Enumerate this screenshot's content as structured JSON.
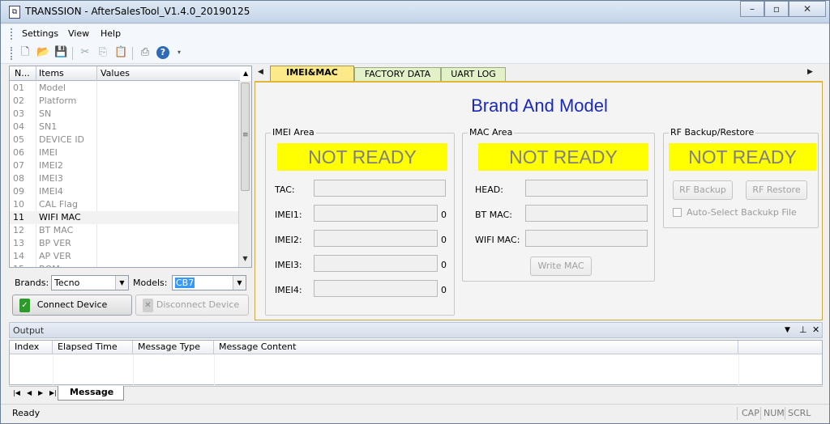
{
  "window": {
    "title": "TRANSSION - AfterSalesTool_V1.4.0_20190125"
  },
  "menu": [
    "Settings",
    "View",
    "Help"
  ],
  "toolbar_icons": [
    "new-icon",
    "open-icon",
    "save-icon",
    "cut-icon",
    "copy-icon",
    "paste-icon",
    "print-icon",
    "help-icon"
  ],
  "grid": {
    "headers": [
      "N...",
      "Items",
      "Values"
    ],
    "rows": [
      {
        "n": "01",
        "item": "Model"
      },
      {
        "n": "02",
        "item": "Platform"
      },
      {
        "n": "03",
        "item": "SN"
      },
      {
        "n": "04",
        "item": "SN1"
      },
      {
        "n": "05",
        "item": "DEVICE ID"
      },
      {
        "n": "06",
        "item": "IMEI"
      },
      {
        "n": "07",
        "item": "IMEI2"
      },
      {
        "n": "08",
        "item": "IMEI3"
      },
      {
        "n": "09",
        "item": "IMEI4"
      },
      {
        "n": "10",
        "item": "CAL Flag"
      },
      {
        "n": "11",
        "item": "WIFI MAC"
      },
      {
        "n": "12",
        "item": "BT MAC"
      },
      {
        "n": "13",
        "item": "BP VER"
      },
      {
        "n": "14",
        "item": "AP VER"
      },
      {
        "n": "15",
        "item": "ROM"
      }
    ]
  },
  "brands": {
    "label": "Brands:",
    "value": "Tecno"
  },
  "models": {
    "label": "Models:",
    "value": "CB7"
  },
  "buttons": {
    "connect": "Connect Device",
    "disconnect": "Disconnect Device"
  },
  "tabs": [
    "IMEI&MAC",
    "FACTORY DATA",
    "UART LOG"
  ],
  "brand_title": "Brand And Model",
  "imei_area": {
    "title": "IMEI Area",
    "status": "NOT READY",
    "fields": [
      {
        "label": "TAC:",
        "count": ""
      },
      {
        "label": "IMEI1:",
        "count": "0"
      },
      {
        "label": "IMEI2:",
        "count": "0"
      },
      {
        "label": "IMEI3:",
        "count": "0"
      },
      {
        "label": "IMEI4:",
        "count": "0"
      }
    ]
  },
  "mac_area": {
    "title": "MAC Area",
    "status": "NOT READY",
    "fields": [
      {
        "label": "HEAD:"
      },
      {
        "label": "BT MAC:"
      },
      {
        "label": "WIFI MAC:"
      }
    ],
    "write_button": "Write MAC"
  },
  "rf_area": {
    "title": "RF Backup/Restore",
    "status": "NOT READY",
    "backup_button": "RF Backup",
    "restore_button": "RF Restore",
    "auto_select": "Auto-Select Backukp File"
  },
  "output": {
    "title": "Output",
    "columns": [
      "Index",
      "Elapsed Time",
      "Message Type",
      "Message Content"
    ],
    "tab": "Message"
  },
  "status": {
    "ready": "Ready",
    "cap": "CAP",
    "num": "NUM",
    "scrl": "SCRL"
  },
  "colors": {
    "not_ready_bg": "#ffff00",
    "brand_title": "#1a2ab8",
    "active_tab": "#fbe98a",
    "inactive_tab": "#e3f1c9"
  }
}
